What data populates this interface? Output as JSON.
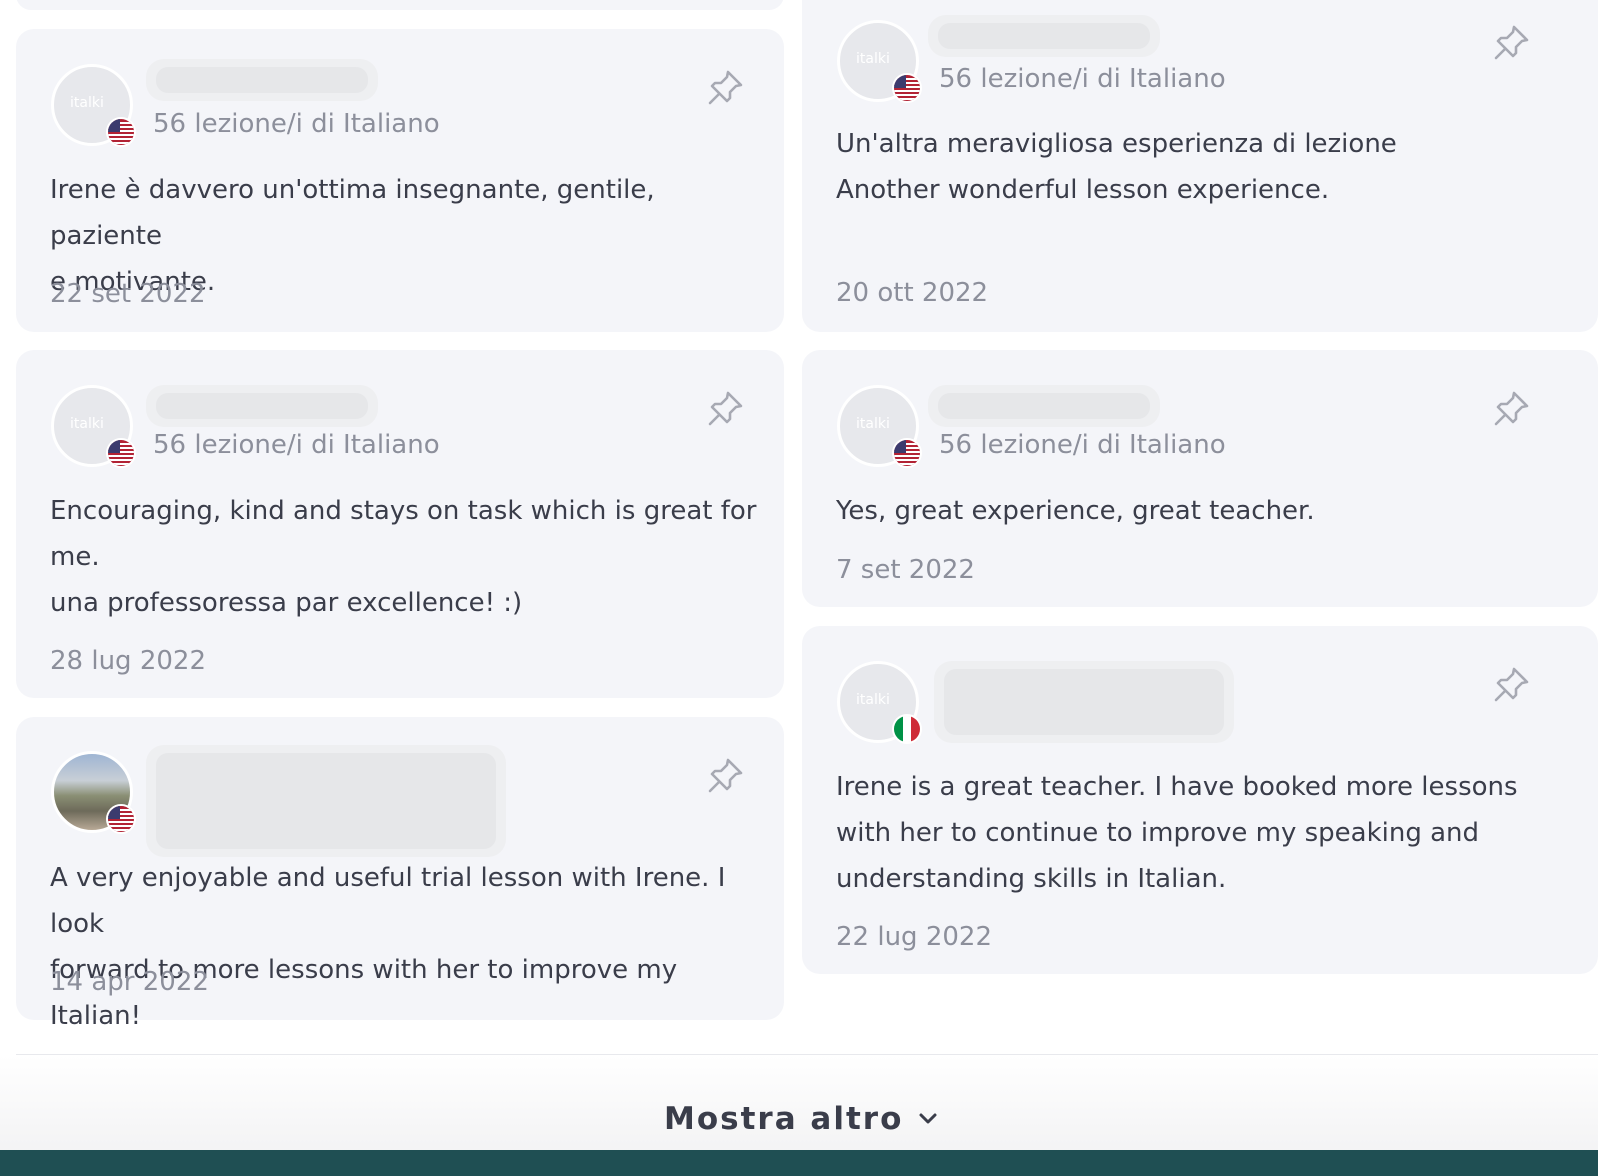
{
  "reviews": [
    {
      "flag": "us",
      "avatar": "italki-logo",
      "meta": "56 lezione/i di Italiano",
      "text": [
        "Irene è davvero un'ottima insegnante, gentile, paziente",
        "e motivante."
      ],
      "date": "22 set 2022"
    },
    {
      "flag": "us",
      "avatar": "italki-logo",
      "meta": "56 lezione/i di Italiano",
      "text": [
        "Un'altra meravigliosa esperienza di lezione",
        "Another wonderful lesson experience."
      ],
      "date": "20 ott 2022"
    },
    {
      "flag": "us",
      "avatar": "italki-logo",
      "meta": "56 lezione/i di Italiano",
      "text": [
        "Encouraging, kind and stays on task which is great for",
        "me.",
        "una professoressa par excellence! :)"
      ],
      "date": "28 lug 2022"
    },
    {
      "flag": "us",
      "avatar": "italki-logo",
      "meta": "56 lezione/i di Italiano",
      "text": [
        "Yes, great experience, great teacher."
      ],
      "date": "7 set 2022"
    },
    {
      "flag": "us",
      "avatar": "photo",
      "meta": "",
      "text": [
        "A very enjoyable and useful trial lesson with Irene. I look",
        "forward to more lessons with her to improve my Italian!"
      ],
      "date": "14 apr 2022"
    },
    {
      "flag": "it",
      "avatar": "italki-logo",
      "meta": "",
      "text": [
        "Irene is a great teacher. I have booked more lessons",
        "with her to continue to improve my speaking and",
        "understanding skills in Italian."
      ],
      "date": "22 lug 2022"
    }
  ],
  "avatar_logo_text": "italki",
  "show_more": {
    "label": "Mostra altro",
    "icon": "chevron-down-icon"
  },
  "icons": {
    "pin": "pin-icon"
  },
  "colors": {
    "card_bg": "#f4f5f9",
    "muted_text": "#8c8f9b",
    "body_text": "#3a3d4a",
    "footer_bar": "#1f4f53"
  }
}
